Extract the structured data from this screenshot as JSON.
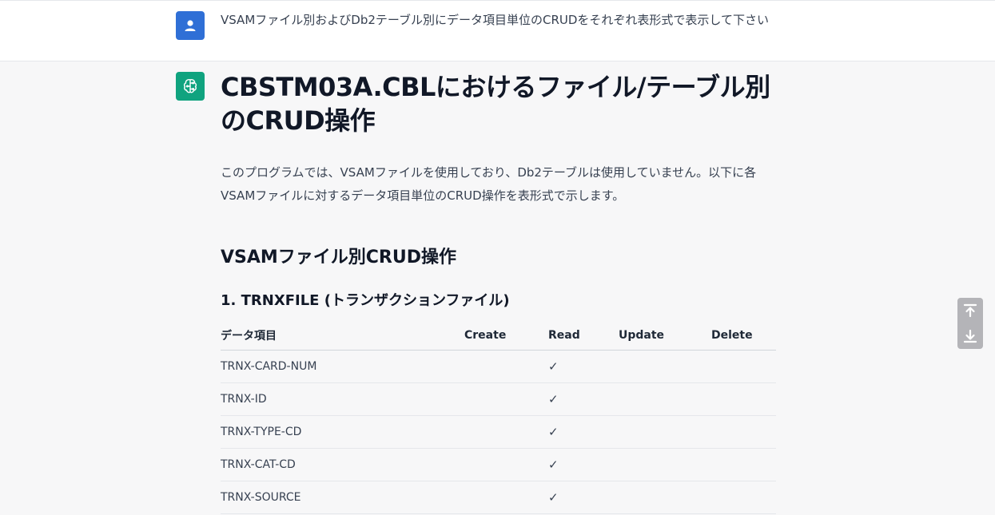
{
  "user_message": {
    "text": "VSAMファイル別およびDb2テーブル別にデータ項目単位のCRUDをそれぞれ表形式で表示して下さい"
  },
  "answer": {
    "title": "CBSTM03A.CBLにおけるファイル/テーブル別のCRUD操作",
    "intro": "このプログラムでは、VSAMファイルを使用しており、Db2テーブルは使用していません。以下に各VSAMファイルに対するデータ項目単位のCRUD操作を表形式で示します。",
    "section_heading": "VSAMファイル別CRUD操作",
    "subsection_heading": "1. TRNXFILE (トランザクションファイル)",
    "table": {
      "headers": [
        "データ項目",
        "Create",
        "Read",
        "Update",
        "Delete"
      ],
      "rows": [
        [
          "TRNX-CARD-NUM",
          "",
          "✓",
          "",
          ""
        ],
        [
          "TRNX-ID",
          "",
          "✓",
          "",
          ""
        ],
        [
          "TRNX-TYPE-CD",
          "",
          "✓",
          "",
          ""
        ],
        [
          "TRNX-CAT-CD",
          "",
          "✓",
          "",
          ""
        ],
        [
          "TRNX-SOURCE",
          "",
          "✓",
          "",
          ""
        ]
      ]
    }
  },
  "icons": {
    "user_avatar": "user-icon",
    "bot_avatar": "brain-circuit-icon",
    "scroll_top": "scroll-to-top-icon",
    "scroll_bottom": "scroll-to-bottom-icon"
  },
  "colors": {
    "user_avatar_bg": "#2f6fd6",
    "bot_avatar_bg": "#10a37f",
    "page_bg": "#f7f7f8"
  }
}
